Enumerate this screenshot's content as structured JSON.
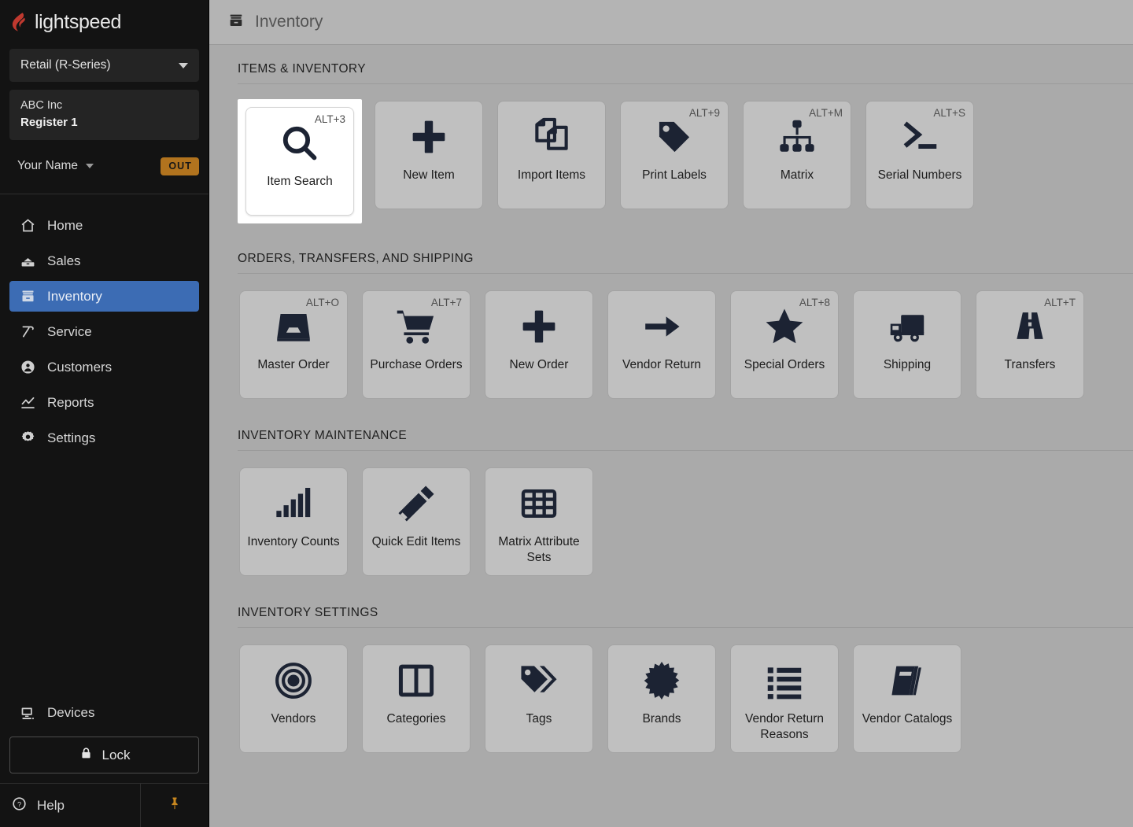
{
  "brand": {
    "name": "lightspeed",
    "flame_color": "#c0392f"
  },
  "sidebar": {
    "product_selector": {
      "label": "Retail (R-Series)",
      "caret_icon": "chevron-down-icon"
    },
    "store": {
      "company": "ABC Inc",
      "register": "Register 1"
    },
    "user": {
      "name": "Your Name",
      "caret_icon": "chevron-down-icon",
      "status_badge": "OUT",
      "badge_color": "#b1731e"
    },
    "nav": [
      {
        "label": "Home",
        "icon": "home-icon",
        "active": false
      },
      {
        "label": "Sales",
        "icon": "cash-drawer-icon",
        "active": false
      },
      {
        "label": "Inventory",
        "icon": "inventory-box-icon",
        "active": true
      },
      {
        "label": "Service",
        "icon": "hammer-icon",
        "active": false
      },
      {
        "label": "Customers",
        "icon": "person-circle-icon",
        "active": false
      },
      {
        "label": "Reports",
        "icon": "chart-line-icon",
        "active": false
      },
      {
        "label": "Settings",
        "icon": "gear-icon",
        "active": false
      }
    ],
    "active_accent": "#3c6cb4",
    "devices": {
      "label": "Devices",
      "icon": "monitor-icon"
    },
    "lock": {
      "label": "Lock",
      "icon": "lock-icon"
    },
    "footer": {
      "help_label": "Help",
      "help_icon": "question-circle-icon",
      "pin_icon": "pushpin-icon",
      "pin_color": "#c8871f"
    }
  },
  "header": {
    "title": "Inventory",
    "icon": "inventory-box-icon"
  },
  "sections": [
    {
      "title": "ITEMS & INVENTORY",
      "tiles": [
        {
          "label": "Item Search",
          "shortcut": "ALT+3",
          "icon": "magnifier-icon",
          "selected": true
        },
        {
          "label": "New Item",
          "shortcut": "",
          "icon": "plus-icon",
          "selected": false
        },
        {
          "label": "Import Items",
          "shortcut": "",
          "icon": "copy-documents-icon",
          "selected": false
        },
        {
          "label": "Print Labels",
          "shortcut": "ALT+9",
          "icon": "price-tag-icon",
          "selected": false
        },
        {
          "label": "Matrix",
          "shortcut": "ALT+M",
          "icon": "org-tree-icon",
          "selected": false
        },
        {
          "label": "Serial Numbers",
          "shortcut": "ALT+S",
          "icon": "terminal-prompt-icon",
          "selected": false
        }
      ]
    },
    {
      "title": "ORDERS, TRANSFERS, AND SHIPPING",
      "tiles": [
        {
          "label": "Master Order",
          "shortcut": "ALT+O",
          "icon": "inbox-tray-icon",
          "selected": false
        },
        {
          "label": "Purchase Orders",
          "shortcut": "ALT+7",
          "icon": "shopping-cart-icon",
          "selected": false
        },
        {
          "label": "New Order",
          "shortcut": "",
          "icon": "plus-icon",
          "selected": false
        },
        {
          "label": "Vendor Return",
          "shortcut": "",
          "icon": "arrow-right-icon",
          "selected": false
        },
        {
          "label": "Special Orders",
          "shortcut": "ALT+8",
          "icon": "star-icon",
          "selected": false
        },
        {
          "label": "Shipping",
          "shortcut": "",
          "icon": "delivery-truck-icon",
          "selected": false
        },
        {
          "label": "Transfers",
          "shortcut": "ALT+T",
          "icon": "road-icon",
          "selected": false
        }
      ]
    },
    {
      "title": "INVENTORY MAINTENANCE",
      "tiles": [
        {
          "label": "Inventory Counts",
          "shortcut": "",
          "icon": "bar-chart-icon",
          "selected": false
        },
        {
          "label": "Quick Edit Items",
          "shortcut": "",
          "icon": "pencil-icon",
          "selected": false
        },
        {
          "label": "Matrix Attribute Sets",
          "shortcut": "",
          "icon": "grid-table-icon",
          "selected": false
        }
      ]
    },
    {
      "title": "INVENTORY SETTINGS",
      "tiles": [
        {
          "label": "Vendors",
          "shortcut": "",
          "icon": "target-rings-icon",
          "selected": false
        },
        {
          "label": "Categories",
          "shortcut": "",
          "icon": "two-column-icon",
          "selected": false
        },
        {
          "label": "Tags",
          "shortcut": "",
          "icon": "tags-icon",
          "selected": false
        },
        {
          "label": "Brands",
          "shortcut": "",
          "icon": "starburst-icon",
          "selected": false
        },
        {
          "label": "Vendor Return Reasons",
          "shortcut": "",
          "icon": "bullet-list-icon",
          "selected": false
        },
        {
          "label": "Vendor Catalogs",
          "shortcut": "",
          "icon": "book-icon",
          "selected": false
        }
      ]
    }
  ]
}
